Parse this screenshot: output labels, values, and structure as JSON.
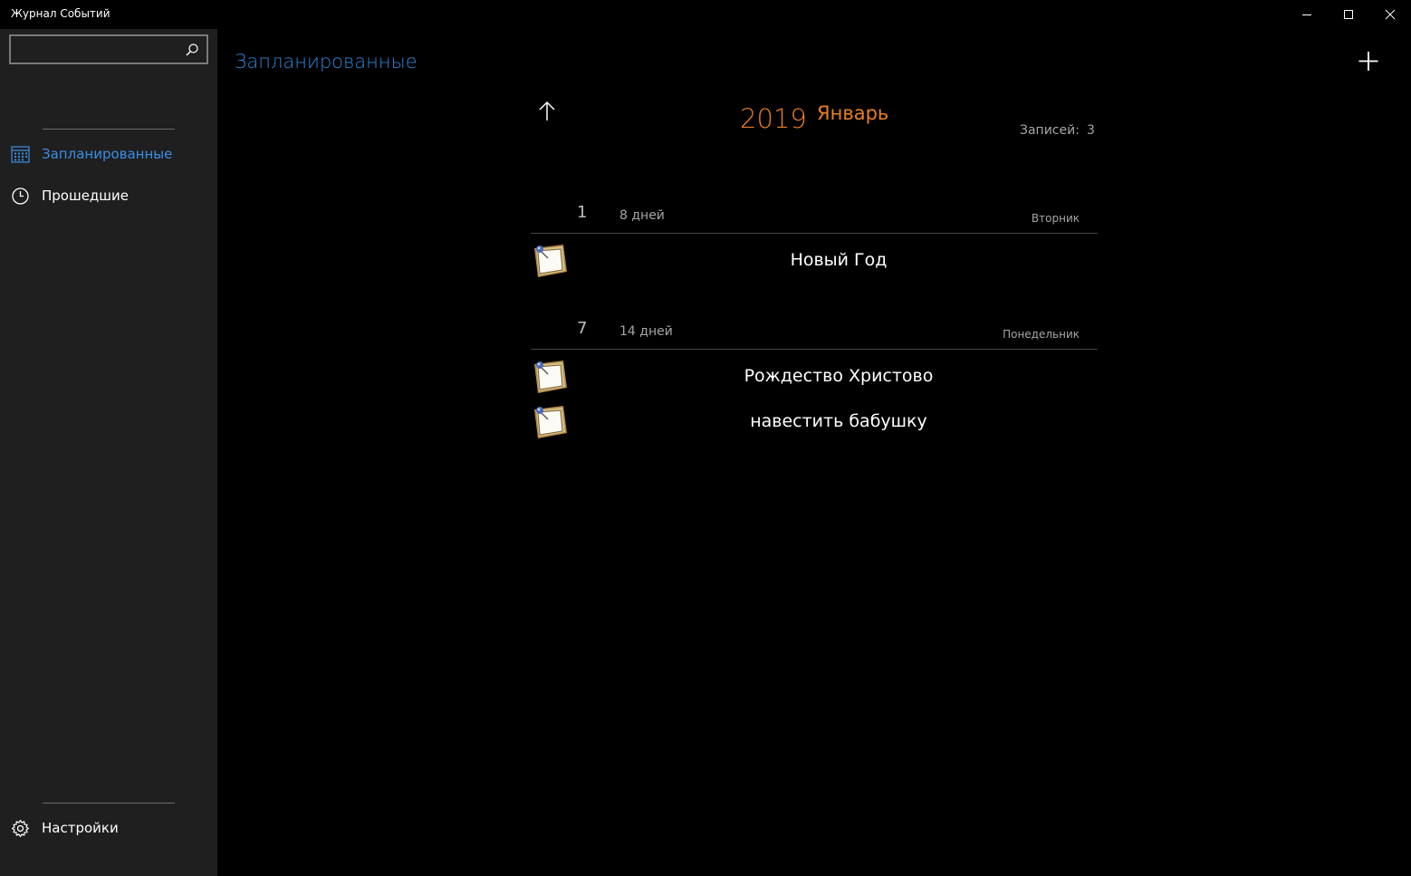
{
  "window": {
    "title": "Журнал Событий"
  },
  "sidebar": {
    "search": {
      "value": "",
      "placeholder": ""
    },
    "items": [
      {
        "label": "Запланированные",
        "icon": "calendar-icon",
        "active": true
      },
      {
        "label": "Прошедшие",
        "icon": "clock-icon",
        "active": false
      }
    ],
    "settings_label": "Настройки"
  },
  "main": {
    "page_title": "Запланированные",
    "year": "2019",
    "month": "Январь",
    "records_label": "Записей:",
    "records_count": "3",
    "groups": [
      {
        "day": "1",
        "days_left": "8 дней",
        "weekday": "Вторник",
        "events": [
          {
            "title": "Новый Год"
          }
        ]
      },
      {
        "day": "7",
        "days_left": "14 дней",
        "weekday": "Понедельник",
        "events": [
          {
            "title": "Рождество Христово"
          },
          {
            "title": "навестить бабушку"
          }
        ]
      }
    ]
  },
  "colors": {
    "accent_blue": "#2f86d8",
    "accent_orange": "#e87f20",
    "sidebar_bg": "#1f1f1f",
    "main_bg": "#000000"
  }
}
